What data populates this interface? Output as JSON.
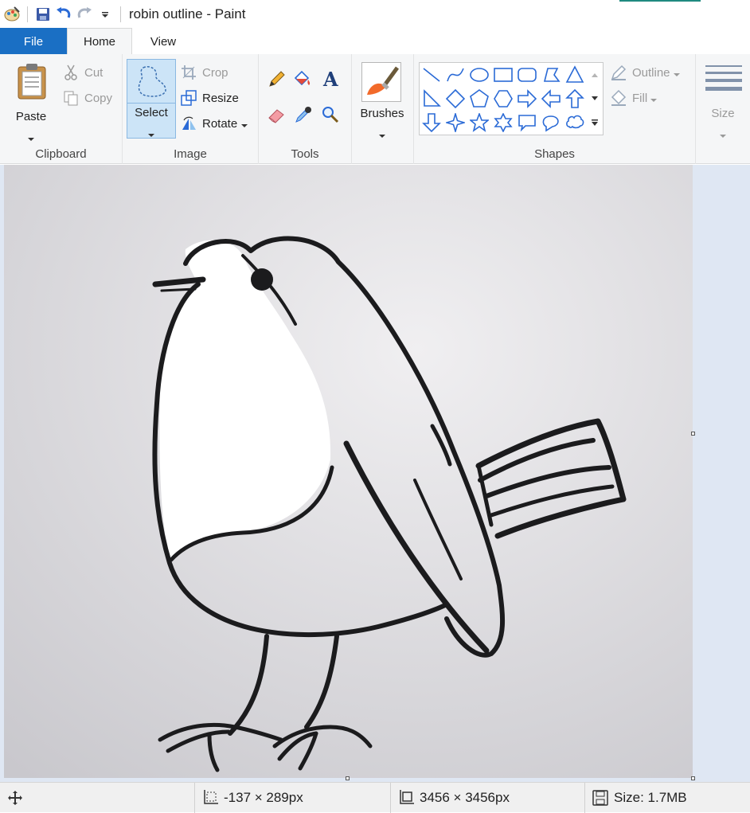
{
  "window": {
    "title": "robin outline - Paint"
  },
  "tabs": [
    {
      "label": "File"
    },
    {
      "label": "Home"
    },
    {
      "label": "View"
    }
  ],
  "ribbon": {
    "clipboard": {
      "label": "Clipboard",
      "paste": "Paste",
      "cut": "Cut",
      "copy": "Copy"
    },
    "image": {
      "label": "Image",
      "select": "Select",
      "crop": "Crop",
      "resize": "Resize",
      "rotate": "Rotate"
    },
    "tools": {
      "label": "Tools"
    },
    "brushes": {
      "label": "Brushes"
    },
    "shapes": {
      "label": "Shapes",
      "outline": "Outline",
      "fill": "Fill"
    },
    "size": {
      "label": "Size"
    }
  },
  "status": {
    "cursor_position": "-137 × 289px",
    "image_dimensions": "3456 × 3456px",
    "file_size": "Size: 1.7MB"
  },
  "colors": {
    "file_tab": "#1a6fc4",
    "accent_line": "#1f8a80",
    "selection": "#cce4f7",
    "canvas_bg": "#dfe7f3"
  }
}
